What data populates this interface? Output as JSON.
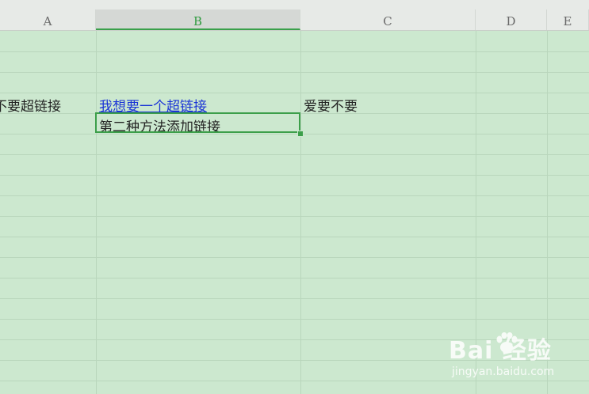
{
  "columns": [
    {
      "label": "A"
    },
    {
      "label": "B"
    },
    {
      "label": "C"
    },
    {
      "label": "D"
    },
    {
      "label": "E"
    }
  ],
  "cells": {
    "a5": "不要超链接",
    "b5": "我想要一个超链接",
    "c5": "爱要不要",
    "b6": "第二种方法添加链接"
  },
  "watermark": {
    "logo": "Bai 经验",
    "site": "jingyan.baidu.com"
  },
  "colors": {
    "sheet_bg": "#cce8cf",
    "selection": "#3c9f4a",
    "link": "#1a33d6"
  }
}
